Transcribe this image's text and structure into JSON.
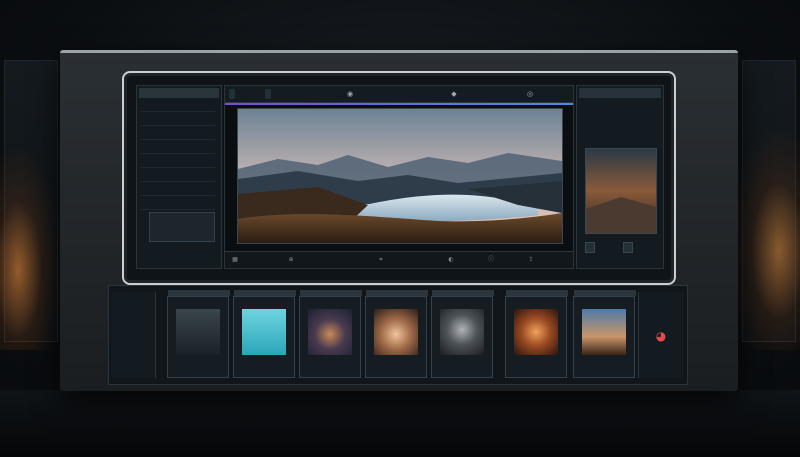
{
  "left_panel": {
    "title": "",
    "rows": [
      {
        "label": "",
        "value": ""
      },
      {
        "label": "",
        "value": ""
      },
      {
        "label": "",
        "value": ""
      },
      {
        "label": "",
        "value": ""
      },
      {
        "label": "",
        "value": ""
      },
      {
        "label": "",
        "value": ""
      },
      {
        "label": "",
        "value": ""
      },
      {
        "label": "",
        "value": ""
      }
    ],
    "brand": ""
  },
  "canvas": {
    "tabs": [
      "",
      ""
    ],
    "toolbar_icons": [
      "eye-icon",
      "diamond-icon",
      "target-icon"
    ]
  },
  "right_panel": {
    "title": "",
    "labels": [
      "",
      ""
    ],
    "buttons": [
      "",
      ""
    ]
  },
  "filmstrip": {
    "side_rows": [
      "",
      "",
      ""
    ],
    "thumbnails": [
      {
        "header": "",
        "label": ""
      },
      {
        "header": "",
        "label": ""
      },
      {
        "header": "",
        "label": ""
      },
      {
        "header": "",
        "label": ""
      },
      {
        "header": "",
        "label": ""
      },
      {
        "header": "",
        "label": ""
      },
      {
        "header": "",
        "label": ""
      }
    ]
  },
  "colors": {
    "accent": "#7a4fc9",
    "accent2": "#4b8be6",
    "frame": "#c9cfd3"
  }
}
